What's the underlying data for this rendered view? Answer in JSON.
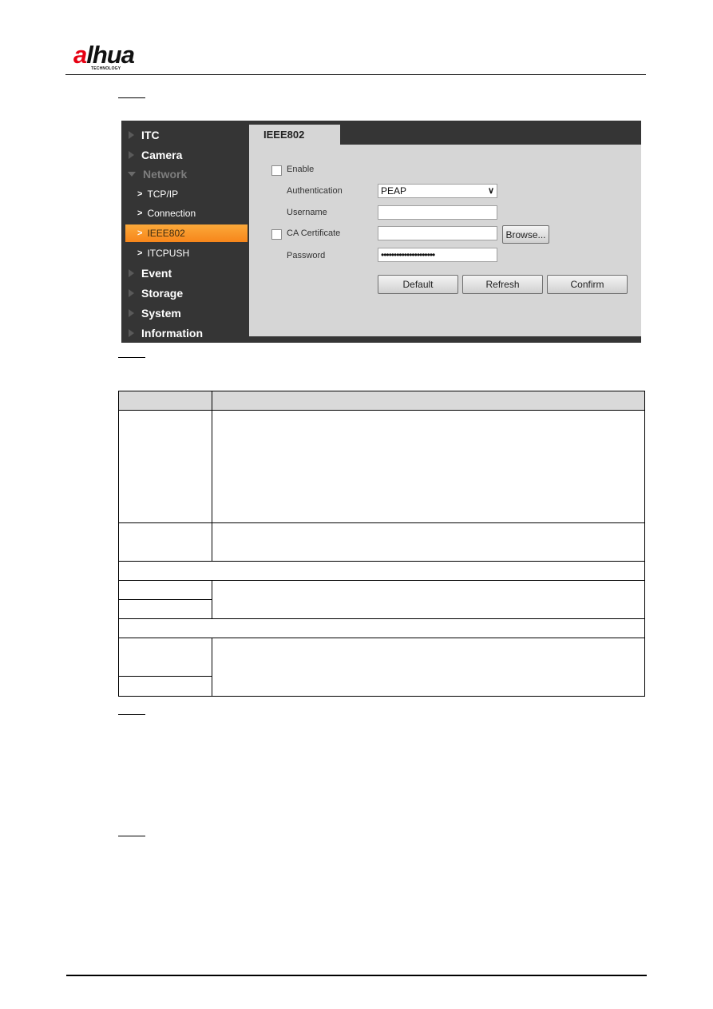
{
  "header": {
    "logo_main": "alhua",
    "logo_sub": "TECHNOLOGY",
    "brand_color": "#e60012"
  },
  "screenshot": {
    "sidebar": {
      "items": [
        {
          "label": "ITC",
          "icon": "triangle-right-icon",
          "expanded": false
        },
        {
          "label": "Camera",
          "icon": "triangle-right-icon",
          "expanded": false
        },
        {
          "label": "Network",
          "icon": "triangle-down-icon",
          "expanded": true
        },
        {
          "label": "Event",
          "icon": "triangle-right-icon",
          "expanded": false
        },
        {
          "label": "Storage",
          "icon": "triangle-right-icon",
          "expanded": false
        },
        {
          "label": "System",
          "icon": "triangle-right-icon",
          "expanded": false
        },
        {
          "label": "Information",
          "icon": "triangle-right-icon",
          "expanded": false
        }
      ],
      "network_subitems": [
        {
          "label": "TCP/IP",
          "active": false
        },
        {
          "label": "Connection",
          "active": false
        },
        {
          "label": "IEEE802",
          "active": true
        },
        {
          "label": "ITCPUSH",
          "active": false
        }
      ],
      "active_color": "#f7861b",
      "background_color": "#353535"
    },
    "tab": {
      "label": "IEEE802"
    },
    "form": {
      "enable": {
        "label": "Enable",
        "checked": false
      },
      "authentication": {
        "label": "Authentication",
        "value": "PEAP"
      },
      "username": {
        "label": "Username",
        "value": ""
      },
      "ca_certificate": {
        "label": "CA Certificate",
        "checked": false,
        "value": "",
        "browse_label": "Browse..."
      },
      "password": {
        "label": "Password",
        "value": "•••••••••••••••••••••"
      }
    },
    "buttons": {
      "default": "Default",
      "refresh": "Refresh",
      "confirm": "Confirm"
    }
  },
  "table": {
    "headers": [
      "",
      ""
    ],
    "rows": [
      [
        "",
        ""
      ],
      [
        "",
        ""
      ],
      [
        ""
      ],
      [
        "",
        ""
      ],
      [
        ""
      ],
      [
        ""
      ],
      [
        "",
        ""
      ],
      [
        ""
      ]
    ]
  }
}
